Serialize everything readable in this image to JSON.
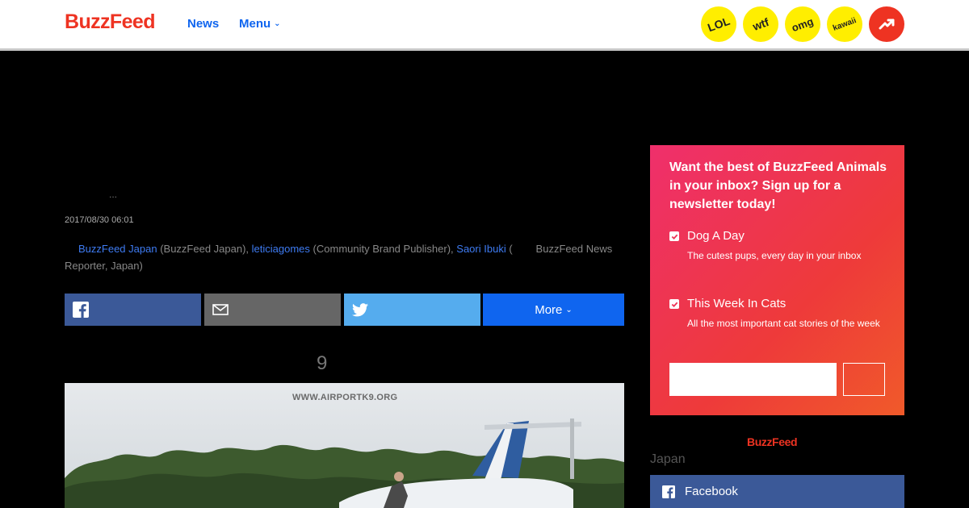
{
  "header": {
    "logo": "BuzzFeed",
    "nav": {
      "news": "News",
      "menu": "Menu"
    },
    "badges": [
      "LOL",
      "wtf",
      "omg",
      "kawaii"
    ]
  },
  "article": {
    "ellipsis": "...",
    "date": "2017/08/30 06:01",
    "byline": {
      "author1": "BuzzFeed Japan",
      "author1_role": "(BuzzFeed Japan), ",
      "author2": "leticiagomes",
      "author2_role": "(Community Brand Publisher), ",
      "author3": "Saori Ibuki",
      "author3_role": "(        BuzzFeed News Reporter, Japan)"
    },
    "share": {
      "more": "More"
    },
    "heading_fragment": "9",
    "photo_watermark": "WWW.AIRPORTK9.ORG"
  },
  "newsletter": {
    "title": "Want the best of BuzzFeed Animals in your inbox? Sign up for a newsletter today!",
    "options": [
      {
        "name": "Dog A Day",
        "desc": "The cutest pups, every day in your inbox",
        "checked": true
      },
      {
        "name": "This Week In Cats",
        "desc": "All the most important cat stories of the week",
        "checked": true
      }
    ],
    "email_placeholder": ""
  },
  "sidebar": {
    "logo": "BuzzFeed",
    "region": "Japan",
    "facebook_label": "Facebook"
  }
}
